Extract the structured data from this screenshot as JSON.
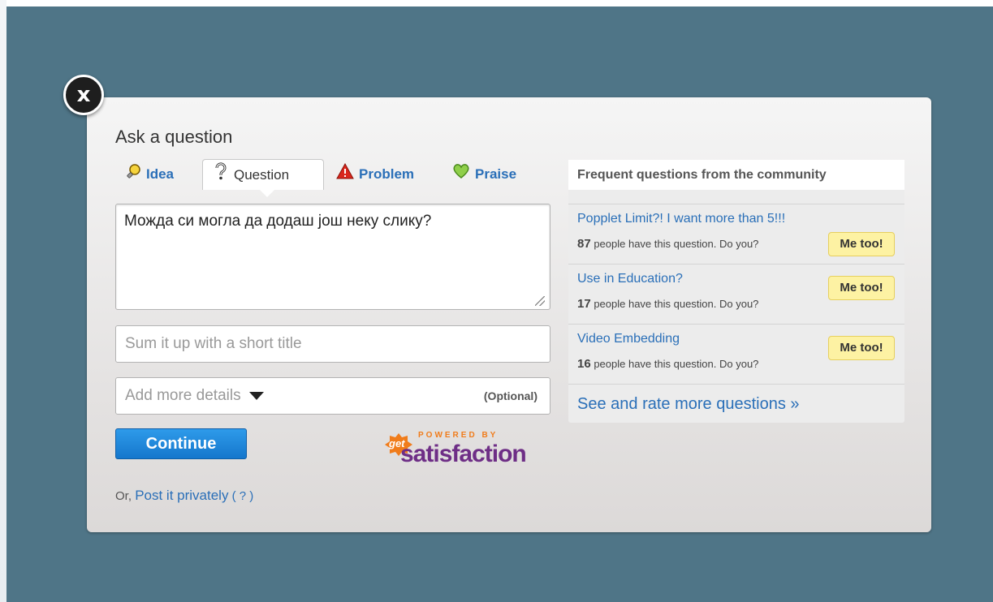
{
  "close": {
    "label": "x"
  },
  "dialog": {
    "title": "Ask a question"
  },
  "tabs": [
    {
      "label": "Idea",
      "icon": "lightbulb-icon"
    },
    {
      "label": "Question",
      "icon": "question-icon"
    },
    {
      "label": "Problem",
      "icon": "warning-icon"
    },
    {
      "label": "Praise",
      "icon": "heart-icon"
    }
  ],
  "form": {
    "text": "Можда си могла да додаш још неку слику?",
    "title_placeholder": "Sum it up with a short title",
    "details_label": "Add more details",
    "details_optional": "(Optional)",
    "continue_label": "Continue",
    "private_prefix": "Or,",
    "private_link": "Post it privately",
    "private_help": "( ? )"
  },
  "powered": {
    "powered_by": "POWERED BY",
    "get": "get",
    "brand": "satisfaction"
  },
  "frequent": {
    "header": "Frequent questions from the community",
    "items": [
      {
        "title": "Popplet Limit?! I want more than 5!!!",
        "count": "87",
        "suffix": "people have this question. Do you?",
        "button": "Me too!"
      },
      {
        "title": "Use in Education?",
        "count": "17",
        "suffix": "people have this question. Do you?",
        "button": "Me too!"
      },
      {
        "title": "Video Embedding",
        "count": "16",
        "suffix": "people have this question. Do you?",
        "button": "Me too!"
      }
    ],
    "see_more": "See and rate more questions »"
  },
  "colors": {
    "backdrop": "#4f7587",
    "link": "#2a6fb8",
    "continue": "#1577cc",
    "metoo": "#fdf2a3"
  }
}
